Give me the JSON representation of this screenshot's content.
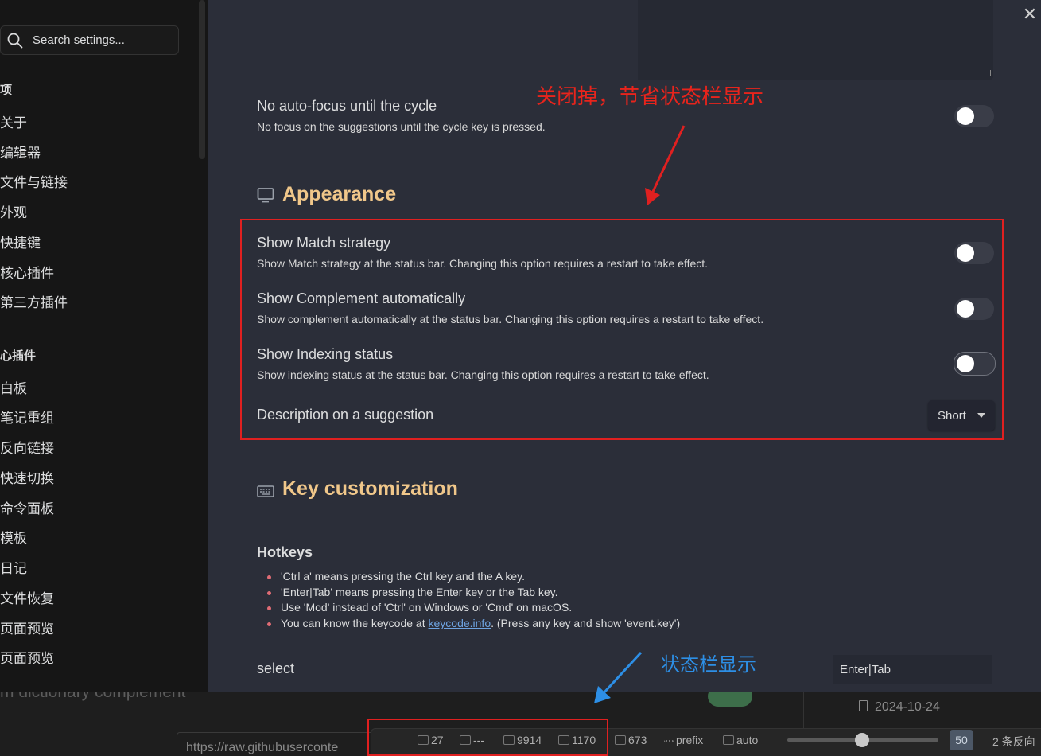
{
  "sidebar": {
    "search_placeholder": "Search settings...",
    "group1_header": "项",
    "group1_items": [
      "关于",
      "编辑器",
      "文件与链接",
      "外观",
      "快捷键",
      "核心插件",
      "第三方插件"
    ],
    "group2_header": "心插件",
    "group2_items": [
      "白板",
      "笔记重组",
      "反向链接",
      "快速切换",
      "命令面板",
      "模板",
      "日记",
      "文件恢复",
      "页面预览",
      "页面预览"
    ]
  },
  "main": {
    "no_autofocus": {
      "name": "No auto-focus until the cycle",
      "desc": "No focus on the suggestions until the cycle key is pressed.",
      "enabled": false
    },
    "appearance_title": "Appearance",
    "show_match_strategy": {
      "name": "Show Match strategy",
      "desc": "Show Match strategy at the status bar. Changing this option requires a restart to take effect.",
      "enabled": false
    },
    "show_complement": {
      "name": "Show Complement automatically",
      "desc": "Show complement automatically at the status bar. Changing this option requires a restart to take effect.",
      "enabled": false
    },
    "show_indexing": {
      "name": "Show Indexing status",
      "desc": "Show indexing status at the status bar. Changing this option requires a restart to take effect.",
      "enabled": false
    },
    "description_on_suggestion": {
      "name": "Description on a suggestion",
      "value": "Short"
    },
    "key_customization_title": "Key customization",
    "hotkeys": {
      "title": "Hotkeys",
      "items": [
        "'Ctrl a' means pressing the Ctrl key and the A key.",
        "'Enter|Tab' means pressing the Enter key or the Tab key.",
        "Use 'Mod' instead of 'Ctrl' on Windows or 'Cmd' on macOS."
      ],
      "last_item_prefix": "You can know the keycode at ",
      "last_item_link": "keycode.info",
      "last_item_suffix": ". (Press any key and show 'event.key')"
    },
    "select": {
      "label": "select",
      "value": "Enter|Tab"
    }
  },
  "annotations": {
    "red_note": "关闭掉，节省状态栏显示",
    "blue_note": "状态栏显示"
  },
  "background": {
    "partial_setting_text": "m dictionary complement",
    "date": "2024-10-24",
    "url": "https://raw.githubuserconte"
  },
  "status_bar": {
    "items": [
      "27",
      "---",
      "9914",
      "1170",
      "673",
      "prefix",
      "auto"
    ],
    "zoom": "50",
    "backlinks": "2 条反向"
  },
  "colors": {
    "accent_heading": "#f0c78a",
    "annotation_red": "#e02020",
    "annotation_blue": "#2d8fe6",
    "panel_bg": "#2b2e39",
    "link": "#6ea3e0"
  }
}
